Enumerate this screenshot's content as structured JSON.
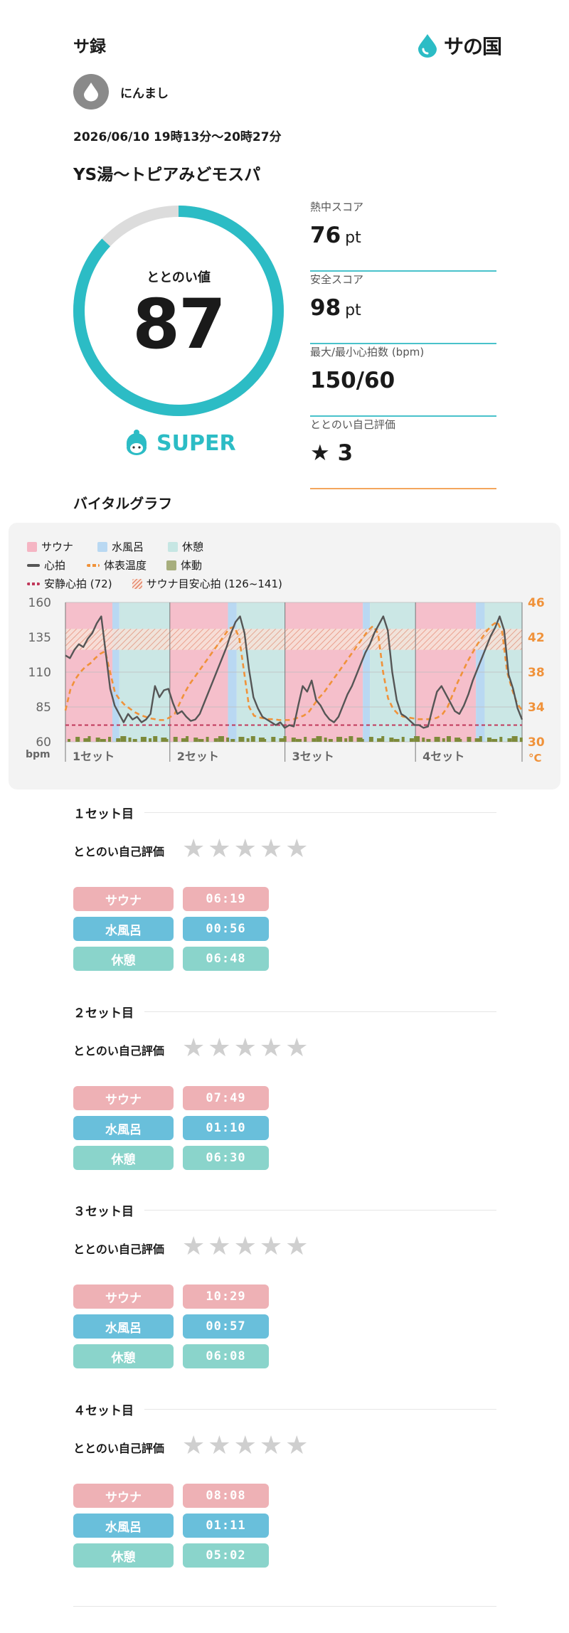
{
  "header": {
    "title": "サ録",
    "brand": "サの国"
  },
  "user": {
    "name": "にんまし"
  },
  "session": {
    "datetime": "2026/06/10 19時13分～20時27分",
    "facility": "YS湯〜トピアみどモスパ"
  },
  "totonoi": {
    "label": "ととのい値",
    "value": "87",
    "fill": 0.87,
    "rank": "SUPER"
  },
  "scores": [
    {
      "label": "熱中スコア",
      "value": "76",
      "unit": "pt",
      "accent": "teal"
    },
    {
      "label": "安全スコア",
      "value": "98",
      "unit": "pt",
      "accent": "teal"
    },
    {
      "label": "最大/最小心拍数 (bpm)",
      "value": "150/60",
      "unit": "",
      "accent": "teal"
    },
    {
      "label": "ととのい自己評価",
      "value": "3",
      "unit": "",
      "star": "★",
      "accent": "orange"
    }
  ],
  "vital": {
    "title": "バイタルグラフ",
    "legend": {
      "sauna": "サウナ",
      "water": "水風呂",
      "rest": "休憩",
      "hr": "心拍",
      "temp": "体表温度",
      "motion": "体動",
      "resting": "安静心拍 (72)",
      "target": "サウナ目安心拍 (126~141)"
    },
    "left_axis": {
      "unit": "bpm",
      "ticks": [
        "160",
        "135",
        "110",
        "85",
        "60"
      ]
    },
    "right_axis": {
      "unit": "°C",
      "ticks": [
        "46",
        "42",
        "38",
        "34",
        "30"
      ]
    },
    "set_labels": [
      "1セット",
      "2セット",
      "3セット",
      "4セット"
    ]
  },
  "colors": {
    "teal": "#2cbcc5",
    "sauna": "#f5b5c3",
    "water": "#b9d8f2",
    "rest": "#c6e6e3",
    "hr": "#555555",
    "temp": "#f0923a",
    "resting": "#c0385a",
    "motion": "#7d8a3a",
    "pill_sauna": "#eeb1b5",
    "pill_water": "#69bfdb",
    "pill_rest": "#8ad4cb"
  },
  "chart_data": {
    "type": "line",
    "title": "バイタルグラフ",
    "ylabel": "bpm",
    "ylim": [
      60,
      160
    ],
    "y2label": "°C",
    "y2lim": [
      30,
      46
    ],
    "x_categories": [
      "1セット",
      "2セット",
      "3セット",
      "4セット"
    ],
    "segments": [
      {
        "set": "1セット",
        "sauna_min": 6.32,
        "water_min": 0.93,
        "rest_min": 6.8
      },
      {
        "set": "2セット",
        "sauna_min": 7.82,
        "water_min": 1.17,
        "rest_min": 6.5
      },
      {
        "set": "3セット",
        "sauna_min": 10.48,
        "water_min": 0.95,
        "rest_min": 6.13
      },
      {
        "set": "4セット",
        "sauna_min": 8.13,
        "water_min": 1.18,
        "rest_min": 5.03
      }
    ],
    "resting_hr": 72,
    "target_hr": [
      126,
      141
    ],
    "series": [
      {
        "name": "心拍",
        "axis": "left",
        "values": [
          122,
          120,
          126,
          130,
          128,
          134,
          138,
          145,
          150,
          124,
          98,
          86,
          80,
          74,
          80,
          76,
          78,
          74,
          76,
          80,
          100,
          92,
          97,
          98,
          88,
          80,
          82,
          78,
          75,
          76,
          80,
          88,
          96,
          104,
          112,
          120,
          128,
          138,
          146,
          150,
          138,
          112,
          92,
          84,
          78,
          76,
          74,
          72,
          74,
          70,
          72,
          71,
          86,
          100,
          96,
          104,
          90,
          86,
          80,
          76,
          74,
          78,
          86,
          94,
          100,
          108,
          116,
          124,
          130,
          138,
          144,
          150,
          140,
          110,
          90,
          80,
          78,
          75,
          72,
          72,
          70,
          71,
          84,
          96,
          100,
          94,
          88,
          82,
          80,
          86,
          94,
          104,
          112,
          120,
          128,
          136,
          142,
          150,
          140,
          108,
          98,
          84,
          76
        ]
      },
      {
        "name": "体表温度",
        "axis": "right",
        "values": [
          33.6,
          36,
          37.2,
          38,
          38.6,
          39,
          39.6,
          40.1,
          40.4,
          38,
          35.6,
          34.8,
          34.2,
          33.8,
          33.4,
          33.1,
          32.9,
          32.7,
          32.6,
          32.5,
          32.5,
          32.8,
          33.2,
          34.4,
          35.6,
          36.6,
          37.4,
          38.2,
          39,
          39.8,
          40.6,
          41.4,
          42.2,
          43,
          43.2,
          42,
          38,
          34,
          33,
          32.8,
          32.7,
          32.6,
          32.6,
          32.5,
          32.5,
          32.5,
          32.6,
          32.8,
          33,
          33.4,
          34.2,
          35,
          35.6,
          36.4,
          37.2,
          38,
          38.8,
          39.6,
          40.4,
          41.2,
          42,
          42.8,
          43.3,
          42.4,
          38,
          35,
          33.8,
          33.2,
          32.9,
          32.8,
          32.7,
          32.6,
          32.6,
          32.6,
          32.6,
          32.8,
          33.2,
          34,
          35.4,
          36.8,
          38,
          39.2,
          40.2,
          41.2,
          42,
          42.8,
          43.4,
          43.8,
          42.6,
          38,
          36,
          34.4,
          33.6
        ]
      }
    ]
  },
  "sets": [
    {
      "title": "１セット目",
      "rating_label": "ととのい自己評価",
      "stars": [
        "★",
        "★",
        "★",
        "★",
        "★"
      ],
      "rating": 0,
      "sauna_label": "サウナ",
      "sauna_time": "06:19",
      "water_label": "水風呂",
      "water_time": "00:56",
      "rest_label": "休憩",
      "rest_time": "06:48"
    },
    {
      "title": "２セット目",
      "rating_label": "ととのい自己評価",
      "stars": [
        "★",
        "★",
        "★",
        "★",
        "★"
      ],
      "rating": 0,
      "sauna_label": "サウナ",
      "sauna_time": "07:49",
      "water_label": "水風呂",
      "water_time": "01:10",
      "rest_label": "休憩",
      "rest_time": "06:30"
    },
    {
      "title": "３セット目",
      "rating_label": "ととのい自己評価",
      "stars": [
        "★",
        "★",
        "★",
        "★",
        "★"
      ],
      "rating": 0,
      "sauna_label": "サウナ",
      "sauna_time": "10:29",
      "water_label": "水風呂",
      "water_time": "00:57",
      "rest_label": "休憩",
      "rest_time": "06:08"
    },
    {
      "title": "４セット目",
      "rating_label": "ととのい自己評価",
      "stars": [
        "★",
        "★",
        "★",
        "★",
        "★"
      ],
      "rating": 0,
      "sauna_label": "サウナ",
      "sauna_time": "08:08",
      "water_label": "水風呂",
      "water_time": "01:11",
      "rest_label": "休憩",
      "rest_time": "05:02"
    }
  ]
}
